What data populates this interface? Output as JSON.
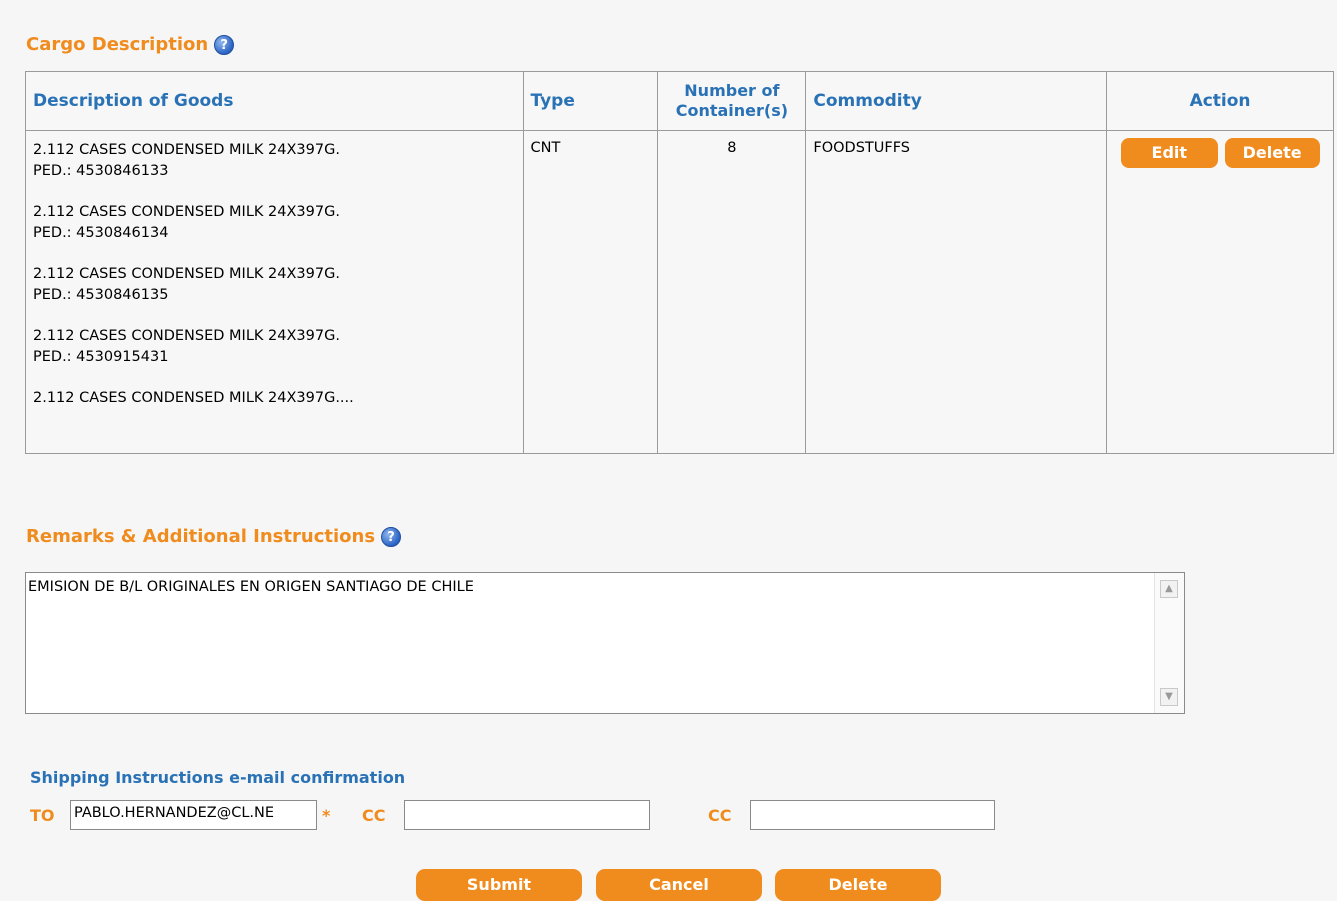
{
  "cargo": {
    "title": "Cargo Description",
    "help_icon": "?",
    "columns": {
      "description": "Description of Goods",
      "type": "Type",
      "containers": "Number of\nContainer(s)",
      "commodity": "Commodity",
      "action": "Action"
    },
    "row": {
      "goods": [
        "2.112 CASES CONDENSED MILK 24X397G.\nPED.: 4530846133",
        "2.112 CASES CONDENSED MILK 24X397G.\nPED.: 4530846134",
        "2.112 CASES CONDENSED MILK 24X397G.\nPED.: 4530846135",
        "2.112 CASES CONDENSED MILK 24X397G.\nPED.: 4530915431",
        "2.112 CASES CONDENSED MILK 24X397G...."
      ],
      "type": "CNT",
      "containers": "8",
      "commodity": "FOODSTUFFS",
      "edit_label": "Edit",
      "delete_label": "Delete"
    }
  },
  "remarks": {
    "title": "Remarks & Additional Instructions",
    "help_icon": "?",
    "text": "EMISION DE B/L ORIGINALES EN ORIGEN SANTIAGO DE CHILE"
  },
  "email": {
    "title": "Shipping Instructions e-mail confirmation",
    "to_label": "TO",
    "to_value": "PABLO.HERNANDEZ@CL.NE",
    "required_mark": "*",
    "cc1_label": "CC",
    "cc1_value": "",
    "cc2_label": "CC",
    "cc2_value": ""
  },
  "buttons": {
    "submit": "Submit",
    "cancel": "Cancel",
    "delete": "Delete"
  },
  "colors": {
    "accent_orange": "#f08c1e",
    "header_blue": "#2a72b6"
  }
}
